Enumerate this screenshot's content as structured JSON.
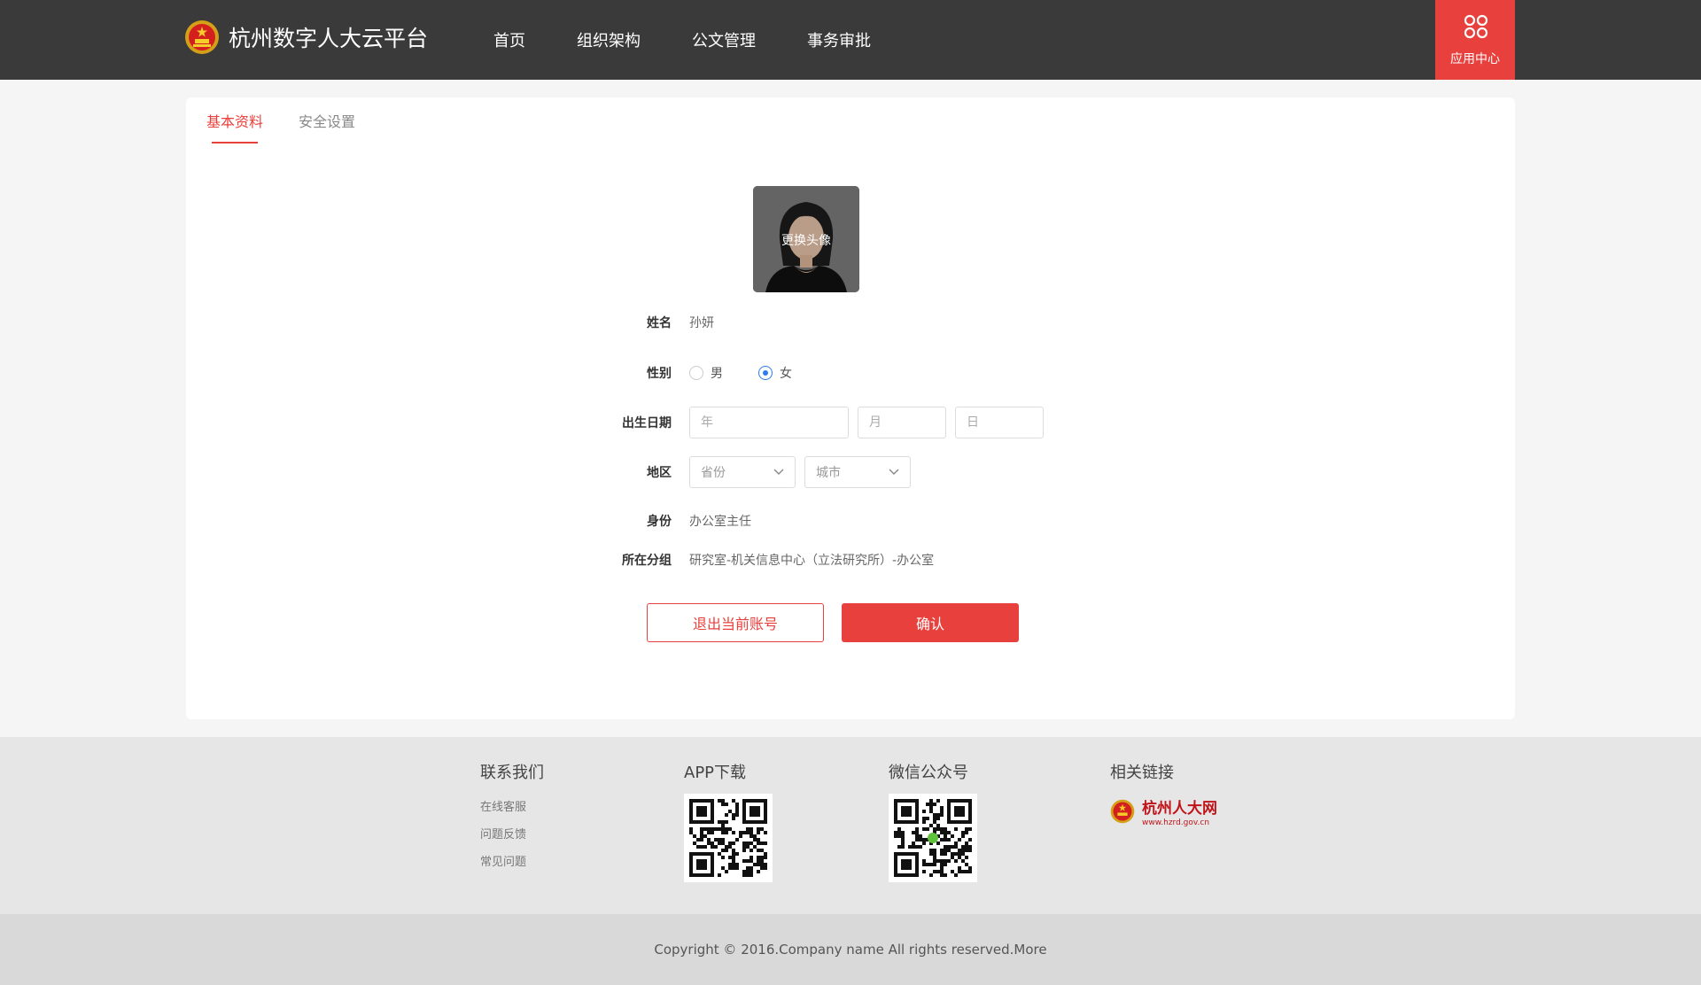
{
  "header": {
    "title": "杭州数字人大云平台",
    "nav": [
      "首页",
      "组织架构",
      "公文管理",
      "事务审批"
    ],
    "app_center": "应用中心"
  },
  "tabs": [
    "基本资料",
    "安全设置"
  ],
  "profile": {
    "avatar_change": "更换头像",
    "name_label": "姓名",
    "name_value": "孙妍",
    "gender_label": "性别",
    "gender_options": [
      "男",
      "女"
    ],
    "gender_selected": "女",
    "birth_label": "出生日期",
    "birth_year_placeholder": "年",
    "birth_month_placeholder": "月",
    "birth_day_placeholder": "日",
    "region_label": "地区",
    "province_placeholder": "省份",
    "city_placeholder": "城市",
    "identity_label": "身份",
    "identity_value": "办公室主任",
    "group_label": "所在分组",
    "group_value": "研究室-机关信息中心（立法研究所）-办公室",
    "logout_button": "退出当前账号",
    "confirm_button": "确认"
  },
  "footer": {
    "contact_title": "联系我们",
    "contact_links": [
      "在线客服",
      "问题反馈",
      "常见问题"
    ],
    "app_title": "APP下载",
    "wechat_title": "微信公众号",
    "links_title": "相关链接",
    "partner_name": "杭州人大网",
    "partner_url": "www.hzrd.gov.cn",
    "copyright": "Copyright © 2016.Company name All rights reserved.More"
  },
  "colors": {
    "accent": "#e8403c",
    "header_bg": "#3a3a3a",
    "radio_checked": "#2b7cf0"
  }
}
